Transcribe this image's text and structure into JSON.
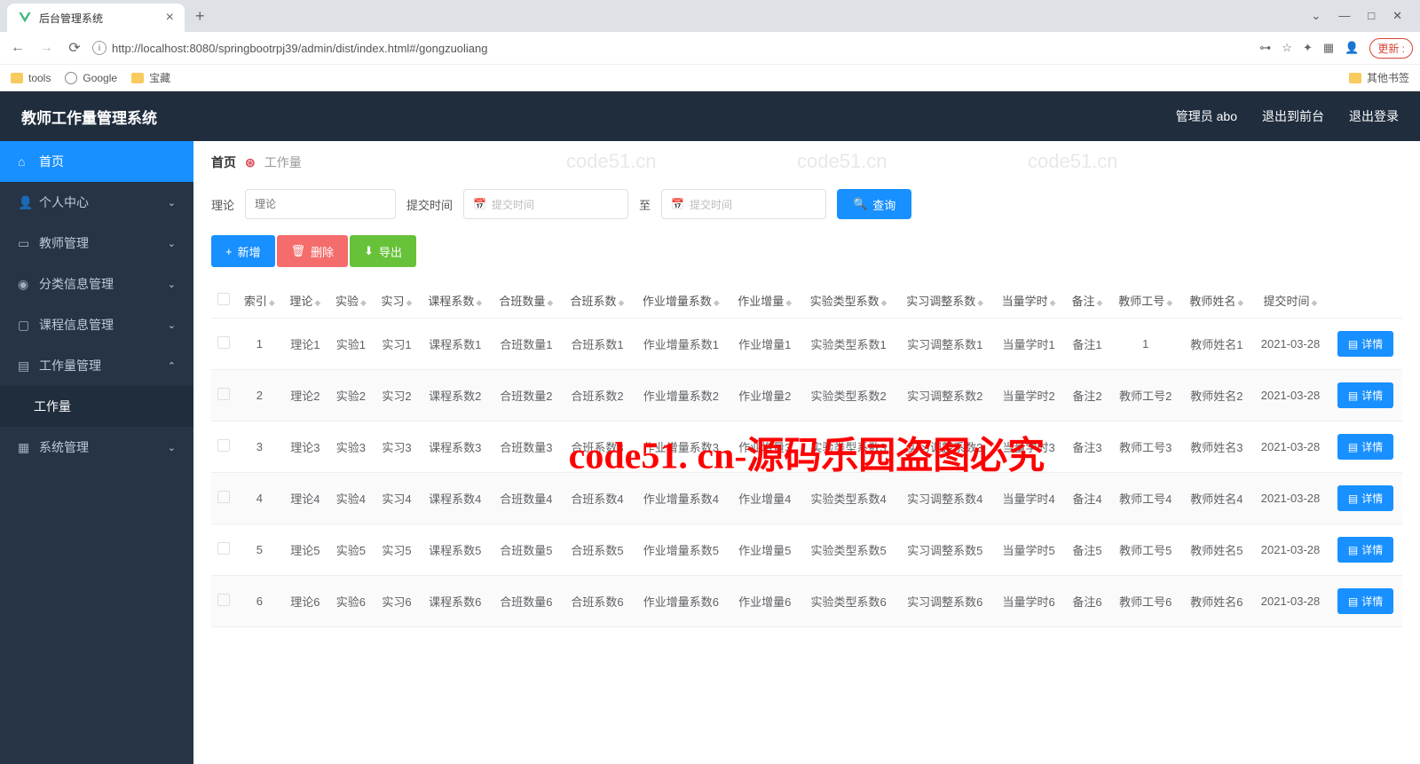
{
  "browser": {
    "tab_title": "后台管理系统",
    "url": "http://localhost:8080/springbootrpj39/admin/dist/index.html#/gongzuoliang",
    "update": "更新 :",
    "bookmarks": {
      "tools": "tools",
      "google": "Google",
      "baozang": "宝藏",
      "other": "其他书签"
    }
  },
  "header": {
    "title": "教师工作量管理系统",
    "user": "管理员 abo",
    "exit_front": "退出到前台",
    "logout": "退出登录"
  },
  "sidebar": {
    "home": "首页",
    "personal": "个人中心",
    "teacher": "教师管理",
    "category": "分类信息管理",
    "course": "课程信息管理",
    "workload_mgmt": "工作量管理",
    "workload": "工作量",
    "system": "系统管理"
  },
  "breadcrumb": {
    "home": "首页",
    "current": "工作量"
  },
  "search": {
    "theory_label": "理论",
    "theory_ph": "理论",
    "submit_label": "提交时间",
    "date_ph1": "提交时间",
    "to": "至",
    "date_ph2": "提交时间",
    "query": "查询"
  },
  "actions": {
    "add": "新增",
    "delete": "删除",
    "export": "导出"
  },
  "table": {
    "headers": [
      "",
      "索引",
      "理论",
      "实验",
      "实习",
      "课程系数",
      "合班数量",
      "合班系数",
      "作业增量系数",
      "作业增量",
      "实验类型系数",
      "实习调整系数",
      "当量学时",
      "备注",
      "教师工号",
      "教师姓名",
      "提交时间",
      ""
    ],
    "detail_label": "详情",
    "rows": [
      {
        "idx": "1",
        "theory": "理论1",
        "exp": "实验1",
        "practice": "实习1",
        "course": "课程系数1",
        "merge_qty": "合班数量1",
        "merge_coef": "合班系数1",
        "hw_inc_coef": "作业增量系数1",
        "hw_inc": "作业增量1",
        "exp_type": "实验类型系数1",
        "adj": "实习调整系数1",
        "eq_hours": "当量学时1",
        "remark": "备注1",
        "tid": "1",
        "tname": "教师姓名1",
        "submit": "2021-03-28"
      },
      {
        "idx": "2",
        "theory": "理论2",
        "exp": "实验2",
        "practice": "实习2",
        "course": "课程系数2",
        "merge_qty": "合班数量2",
        "merge_coef": "合班系数2",
        "hw_inc_coef": "作业增量系数2",
        "hw_inc": "作业增量2",
        "exp_type": "实验类型系数2",
        "adj": "实习调整系数2",
        "eq_hours": "当量学时2",
        "remark": "备注2",
        "tid": "教师工号2",
        "tname": "教师姓名2",
        "submit": "2021-03-28"
      },
      {
        "idx": "3",
        "theory": "理论3",
        "exp": "实验3",
        "practice": "实习3",
        "course": "课程系数3",
        "merge_qty": "合班数量3",
        "merge_coef": "合班系数3",
        "hw_inc_coef": "作业增量系数3",
        "hw_inc": "作业增量3",
        "exp_type": "实验类型系数3",
        "adj": "实习调整系数3",
        "eq_hours": "当量学时3",
        "remark": "备注3",
        "tid": "教师工号3",
        "tname": "教师姓名3",
        "submit": "2021-03-28"
      },
      {
        "idx": "4",
        "theory": "理论4",
        "exp": "实验4",
        "practice": "实习4",
        "course": "课程系数4",
        "merge_qty": "合班数量4",
        "merge_coef": "合班系数4",
        "hw_inc_coef": "作业增量系数4",
        "hw_inc": "作业增量4",
        "exp_type": "实验类型系数4",
        "adj": "实习调整系数4",
        "eq_hours": "当量学时4",
        "remark": "备注4",
        "tid": "教师工号4",
        "tname": "教师姓名4",
        "submit": "2021-03-28"
      },
      {
        "idx": "5",
        "theory": "理论5",
        "exp": "实验5",
        "practice": "实习5",
        "course": "课程系数5",
        "merge_qty": "合班数量5",
        "merge_coef": "合班系数5",
        "hw_inc_coef": "作业增量系数5",
        "hw_inc": "作业增量5",
        "exp_type": "实验类型系数5",
        "adj": "实习调整系数5",
        "eq_hours": "当量学时5",
        "remark": "备注5",
        "tid": "教师工号5",
        "tname": "教师姓名5",
        "submit": "2021-03-28"
      },
      {
        "idx": "6",
        "theory": "理论6",
        "exp": "实验6",
        "practice": "实习6",
        "course": "课程系数6",
        "merge_qty": "合班数量6",
        "merge_coef": "合班系数6",
        "hw_inc_coef": "作业增量系数6",
        "hw_inc": "作业增量6",
        "exp_type": "实验类型系数6",
        "adj": "实习调整系数6",
        "eq_hours": "当量学时6",
        "remark": "备注6",
        "tid": "教师工号6",
        "tname": "教师姓名6",
        "submit": "2021-03-28"
      }
    ]
  },
  "watermark": "code51. cn-源码乐园盗图必究",
  "wm_bg": "code51.cn"
}
